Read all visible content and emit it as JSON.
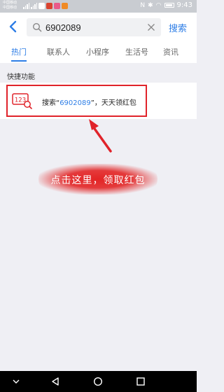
{
  "status_bar": {
    "carrier_1": "中国移动",
    "carrier_2": "中国移动",
    "time": "9:43"
  },
  "header": {
    "search_value": "6902089",
    "search_button_label": "搜索"
  },
  "tabs": [
    {
      "label": "热门",
      "active": true
    },
    {
      "label": "联系人",
      "active": false
    },
    {
      "label": "小程序",
      "active": false
    },
    {
      "label": "生活号",
      "active": false
    },
    {
      "label": "资讯",
      "active": false
    }
  ],
  "section": {
    "title": "快捷功能"
  },
  "quick_action": {
    "icon_text": "123",
    "prefix": "搜索“",
    "keyword": "6902089",
    "suffix": "”，天天领红包"
  },
  "annotation": {
    "text": "点击这里，领取红包",
    "color": "#e0232a"
  },
  "colors": {
    "accent": "#2e7ee6",
    "highlight": "#e0232a"
  }
}
